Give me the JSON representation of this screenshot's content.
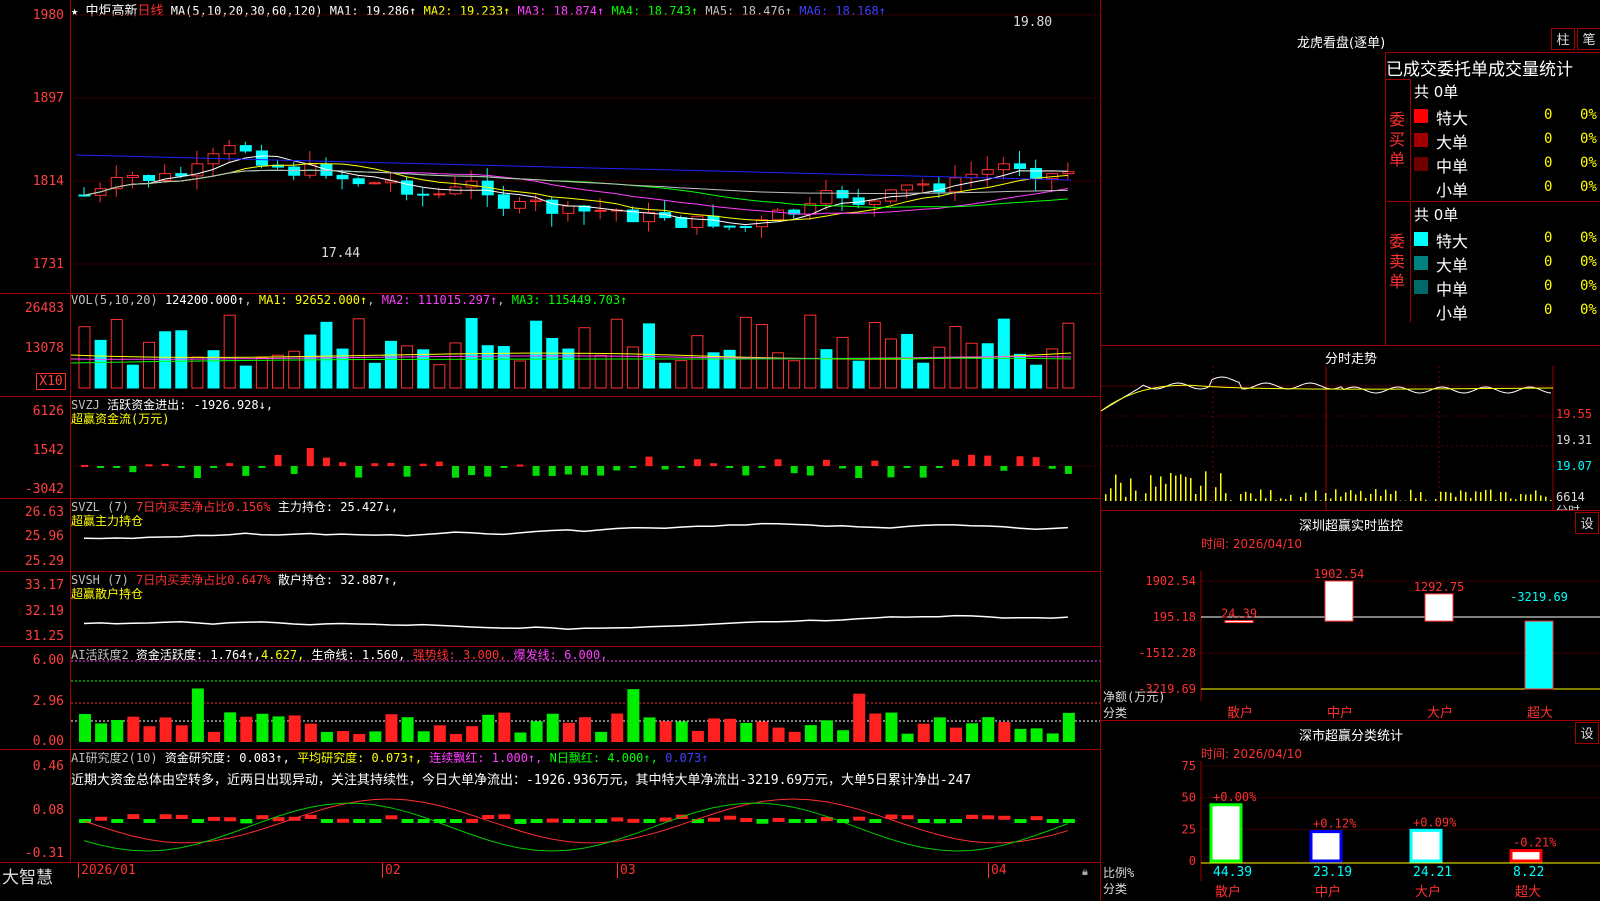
{
  "title_bar": {
    "star": "★",
    "stock": "中炬高新",
    "period": "日线",
    "ma_label": "MA(5,10,20,30,60,120)",
    "ma": [
      {
        "name": "MA1:",
        "value": "19.286↑",
        "color": "#ffffff"
      },
      {
        "name": "MA2:",
        "value": "19.233↑",
        "color": "#ffff00"
      },
      {
        "name": "MA3:",
        "value": "18.874↑",
        "color": "#ff40ff"
      },
      {
        "name": "MA4:",
        "value": "18.743↑",
        "color": "#00ff00"
      },
      {
        "name": "MA5:",
        "value": "18.476↑",
        "color": "#c0c0c0"
      },
      {
        "name": "MA6:",
        "value": "18.168↑",
        "color": "#4040ff"
      }
    ],
    "high_label": "19.80",
    "low_label": "17.44"
  },
  "price_axis": [
    "1980",
    "1897",
    "1814",
    "1731"
  ],
  "vol": {
    "label": "VOL(5,10,20)",
    "value": "124200.000↑",
    "ma1": "MA1: 92652.000↑",
    "ma2": "MA2: 111015.297↑",
    "ma3": "MA3: 115449.703↑",
    "axis": [
      "26483",
      "13078"
    ],
    "unit": "X10"
  },
  "svzj": {
    "label": "SVZJ",
    "text": "活跃资金进出: -1926.928↓,",
    "sub": "超赢资金流(万元)",
    "axis": [
      "6126",
      "1542",
      "-3042"
    ]
  },
  "svzl": {
    "label": "SVZL (7)",
    "text": "7日内买卖净占比0.156%",
    "text2": "主力持仓: 25.427↓,",
    "sub": "超赢主力持仓",
    "axis": [
      "26.63",
      "25.96",
      "25.29"
    ]
  },
  "svsh": {
    "label": "SVSH (7)",
    "text": "7日内买卖净占比0.647%",
    "text2": "散户持仓: 32.887↑,",
    "sub": "超赢散户持仓",
    "axis": [
      "33.17",
      "32.19",
      "31.25"
    ]
  },
  "ai1": {
    "label": "AI活跃度2",
    "text": "资金活跃度: 1.764↑,",
    "t2": "4.627,",
    "t3": "生命线: 1.560,",
    "t4": "强势线: 3.000,",
    "t5": "爆发线: 6.000,",
    "axis": [
      "6.00",
      "2.96",
      "0.00"
    ]
  },
  "ai2": {
    "label": "AI研究度2(10)",
    "text": "资金研究度: 0.083↑,",
    "t2": "平均研究度: 0.073↑,",
    "t3": "连续飘红: 1.000↑,",
    "t4": "N日飘红: 4.000↑,",
    "t5": "0.073↑",
    "comment": "近期大资金总体由空转多，近两日出现异动，关注其持续性，今日大单净流出：-1926.936万元，其中特大单净流出-3219.69万元，大单5日累计净出-247",
    "axis": [
      "0.46",
      "0.08",
      "-0.31"
    ]
  },
  "xaxis": {
    "brand": "大智慧",
    "dates": [
      "2026/01",
      "02",
      "03",
      "04"
    ]
  },
  "lhb": {
    "title": "龙虎看盘(逐单)",
    "btn1": "柱",
    "btn2": "笔",
    "header": "已成交委托单成交量统计",
    "buy_label": "委买单",
    "sell_label": "委卖单",
    "buy": {
      "total": "共 0单",
      "rows": [
        {
          "name": "特大",
          "n": "0",
          "p": "0%",
          "color": "#ff0000"
        },
        {
          "name": "大单",
          "n": "0",
          "p": "0%",
          "color": "#a00000"
        },
        {
          "name": "中单",
          "n": "0",
          "p": "0%",
          "color": "#700000"
        },
        {
          "name": "小单",
          "n": "0",
          "p": "0%",
          "color": "#000000"
        }
      ]
    },
    "sell": {
      "total": "共 0单",
      "rows": [
        {
          "name": "特大",
          "n": "0",
          "p": "0%",
          "color": "#00ffff"
        },
        {
          "name": "大单",
          "n": "0",
          "p": "0%",
          "color": "#008080"
        },
        {
          "name": "中单",
          "n": "0",
          "p": "0%",
          "color": "#006868"
        },
        {
          "name": "小单",
          "n": "0",
          "p": "0%",
          "color": "#000000"
        }
      ]
    }
  },
  "fs": {
    "title": "分时走势",
    "axis": [
      "19.55",
      "19.31",
      "19.07",
      "6614"
    ],
    "unit": "分时"
  },
  "sz": {
    "title": "深圳超赢实时监控",
    "btn": "设",
    "time": "时间: 2026/04/10",
    "axis": [
      "1902.54",
      "195.18",
      "-1512.28",
      "-3219.69"
    ],
    "ylabel": "净额(万元)",
    "xlabel": "分类",
    "cats": [
      "散户",
      "中户",
      "大户",
      "超大"
    ],
    "values": [
      24.39,
      1902.54,
      1292.75,
      -3219.69
    ],
    "vlabels": [
      "24.39",
      "1902.54",
      "1292.75",
      "-3219.69"
    ]
  },
  "cls": {
    "title": "深市超赢分类统计",
    "btn": "设",
    "time": "时间: 2026/04/10",
    "axis": [
      "75",
      "50",
      "25",
      "0"
    ],
    "ylabel": "比例%",
    "xlabel": "分类",
    "cats": [
      "散户",
      "中户",
      "大户",
      "超大"
    ],
    "values": [
      44.39,
      23.19,
      24.21,
      8.22
    ],
    "pct": [
      "+0.00%",
      "+0.12%",
      "+0.09%",
      "-0.21%"
    ],
    "vlabels": [
      "44.39",
      "23.19",
      "24.21",
      "8.22"
    ],
    "colors": [
      "#00ff00",
      "#0000ff",
      "#00ffff",
      "#ff0000"
    ]
  }
}
